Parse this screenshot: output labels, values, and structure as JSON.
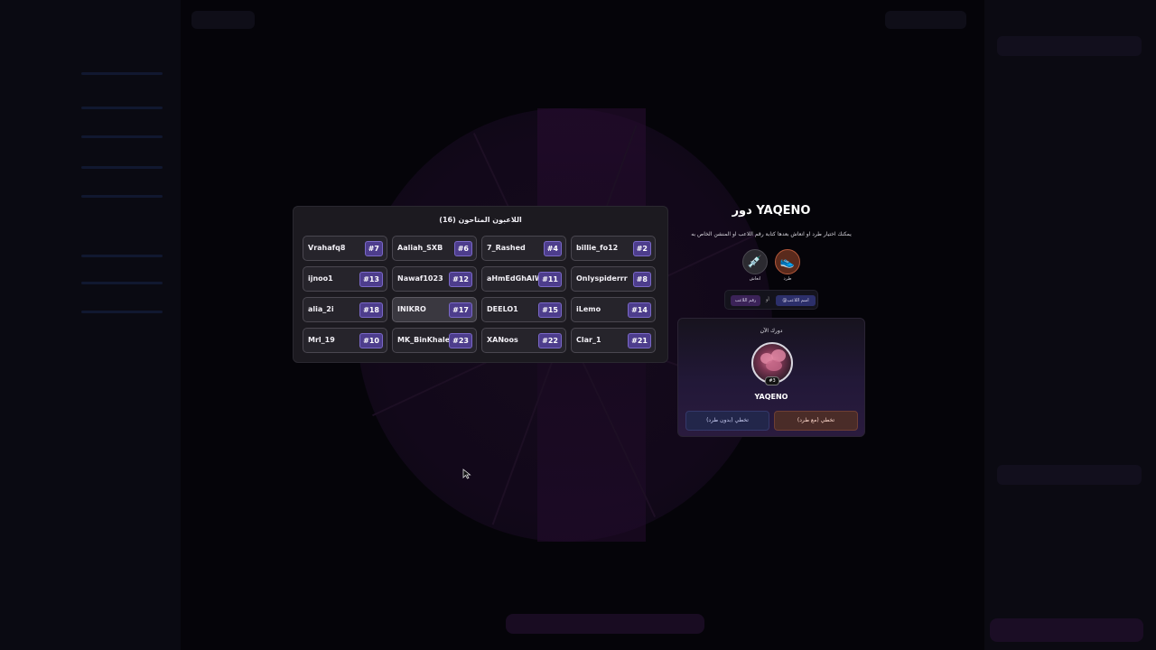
{
  "players_panel": {
    "title": "اللاعبون المتاحون (16)",
    "players": [
      {
        "name": "Vrahafq8",
        "number": "#7",
        "highlight": false
      },
      {
        "name": "Aaliah_SXB",
        "number": "#6",
        "highlight": false
      },
      {
        "name": "7_Rashed",
        "number": "#4",
        "highlight": false
      },
      {
        "name": "billie_fo12",
        "number": "#2",
        "highlight": false
      },
      {
        "name": "ijnoo1",
        "number": "#13",
        "highlight": false
      },
      {
        "name": "Nawaf1023",
        "number": "#12",
        "highlight": false
      },
      {
        "name": "aHmEdGhAlWaShi",
        "number": "#11",
        "highlight": false
      },
      {
        "name": "Onlyspiderrr",
        "number": "#8",
        "highlight": false
      },
      {
        "name": "alia_2i",
        "number": "#18",
        "highlight": false
      },
      {
        "name": "INIKRO",
        "number": "#17",
        "highlight": true
      },
      {
        "name": "DEELO1",
        "number": "#15",
        "highlight": false
      },
      {
        "name": "iLemo",
        "number": "#14",
        "highlight": false
      },
      {
        "name": "Mrl_19",
        "number": "#10",
        "highlight": false
      },
      {
        "name": "MK_BinKhaleD",
        "number": "#23",
        "highlight": false
      },
      {
        "name": "XANoos",
        "number": "#22",
        "highlight": false
      },
      {
        "name": "Clar_1",
        "number": "#21",
        "highlight": false
      }
    ]
  },
  "turn": {
    "title": "دور YAQENO",
    "description": "يمكنك اختيار طرد او انعاش بعدها كتابة رقم اللاعب او المنشن الخاص به",
    "kick_label": "طرد",
    "revive_label": "انعاش",
    "hint_mention": "@اسم اللاعب",
    "hint_or": "أو",
    "hint_number": "رقم اللاعب",
    "now_label": "دورك الآن",
    "player_name": "YAQENO",
    "player_badge": "#3",
    "skip_with_kick": "تخطي (مع طرد)",
    "skip_without_kick": "تخطي (بدون طرد)"
  },
  "colors": {
    "accent_purple": "#4d3d8c",
    "kick_orange": "#b5583a",
    "panel_bg": "#1c1a20"
  }
}
